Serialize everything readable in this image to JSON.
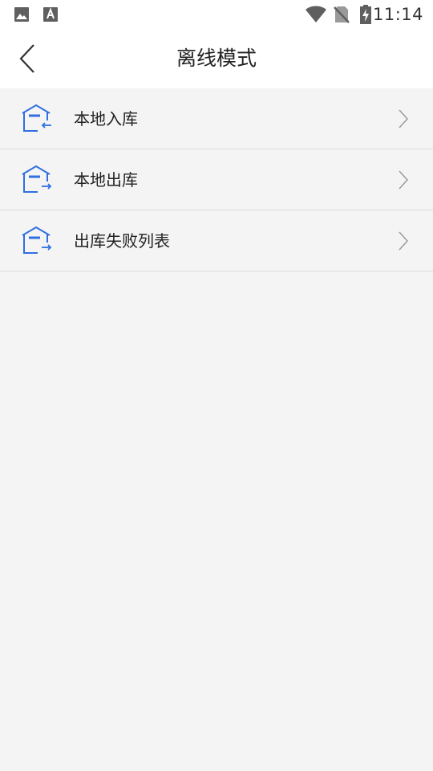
{
  "status_bar": {
    "time": "11:14",
    "left_icons": [
      "image-icon",
      "font-a-icon"
    ],
    "right_icons": [
      "wifi-icon",
      "no-sim-icon",
      "battery-charging-icon"
    ]
  },
  "header": {
    "title": "离线模式",
    "back_icon": "chevron-left-icon"
  },
  "menu": {
    "items": [
      {
        "label": "本地入库",
        "icon": "warehouse-in-icon"
      },
      {
        "label": "本地出库",
        "icon": "warehouse-out-icon"
      },
      {
        "label": "出库失败列表",
        "icon": "warehouse-out-icon"
      }
    ]
  },
  "colors": {
    "accent": "#2f6fe0",
    "background": "#f4f4f4",
    "header_background": "#ffffff",
    "divider": "#dcdcdc"
  }
}
